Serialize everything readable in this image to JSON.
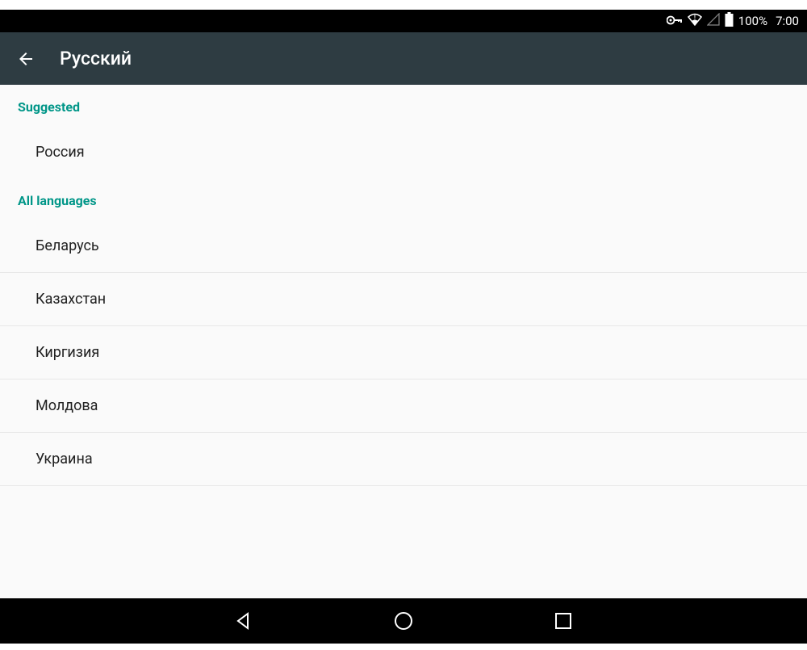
{
  "status_bar": {
    "battery_percent": "100%",
    "clock": "7:00"
  },
  "app_bar": {
    "title": "Русский"
  },
  "sections": {
    "suggested_header": "Suggested",
    "all_header": "All languages",
    "suggested_items": [
      "Россия"
    ],
    "all_items": [
      "Беларусь",
      "Казахстан",
      "Киргизия",
      "Молдова",
      "Украина"
    ]
  }
}
